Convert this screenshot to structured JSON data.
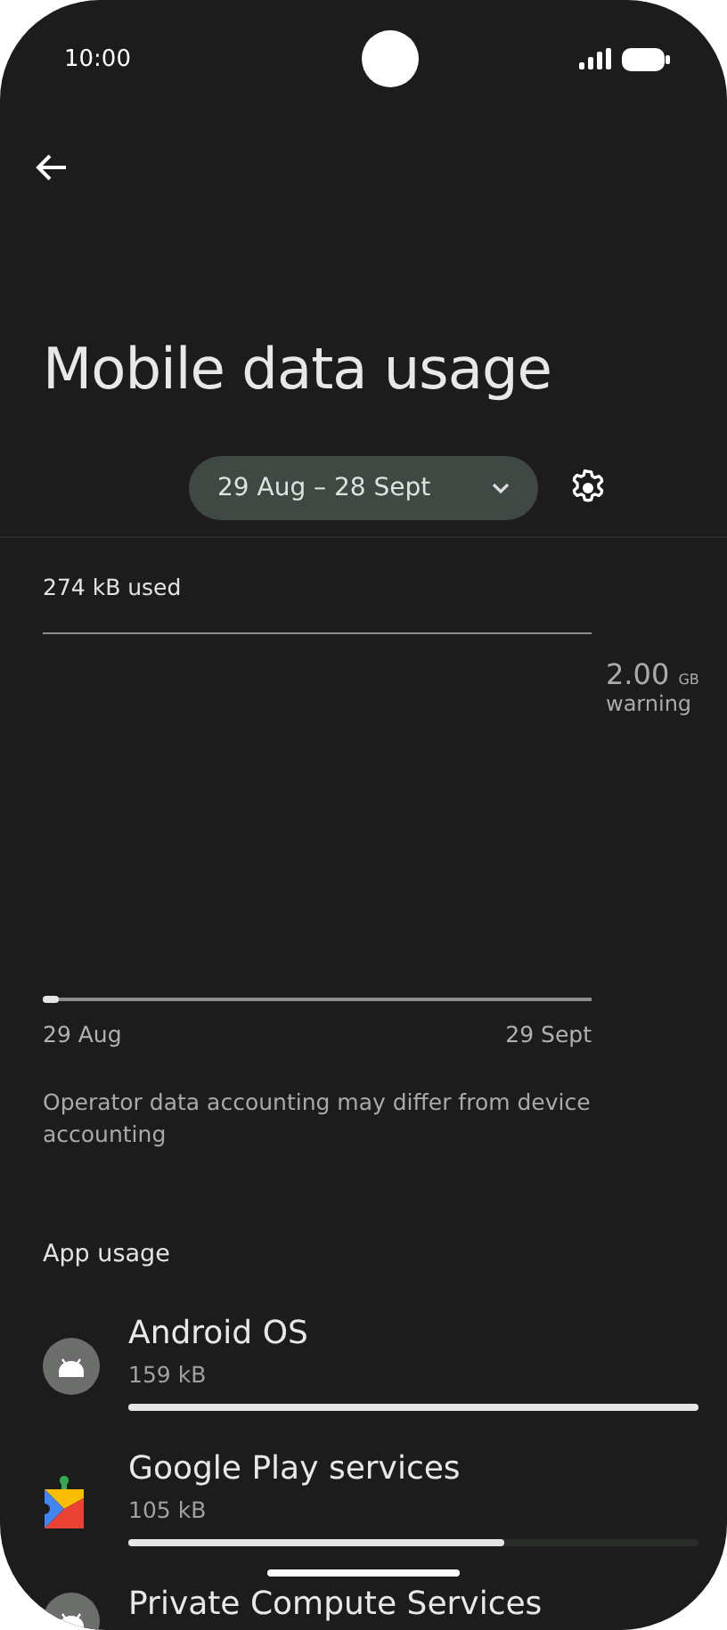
{
  "status_bar": {
    "time": "10:00"
  },
  "title": "Mobile data usage",
  "date_range": {
    "label": "29 Aug – 28 Sept"
  },
  "usage": {
    "used": "274 kB used",
    "warning_value": "2.00",
    "warning_unit": "GB",
    "warning_label": "warning",
    "level": 0.03,
    "start": "29 Aug",
    "end": "29 Sept"
  },
  "note": "Operator data accounting may differ from device accounting",
  "section": "App usage",
  "apps": [
    {
      "kind": "android",
      "name": "Android OS",
      "size": "159 kB",
      "level": 1.0
    },
    {
      "kind": "play",
      "name": "Google Play services",
      "size": "105 kB",
      "level": 0.66
    },
    {
      "kind": "android",
      "name": "Private Compute Services"
    }
  ]
}
